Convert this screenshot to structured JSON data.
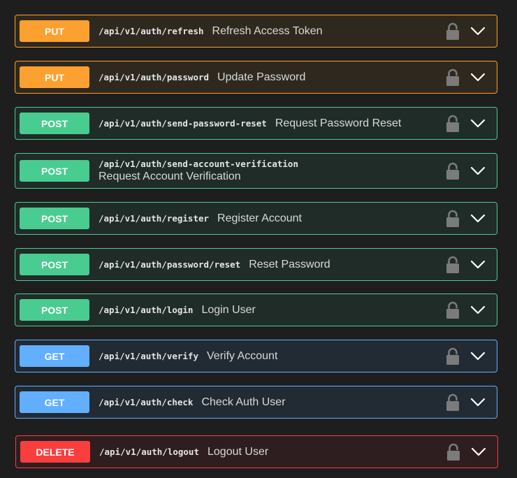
{
  "operations": [
    {
      "method": "PUT",
      "path": "/api/v1/auth/refresh",
      "summary": "Refresh Access Token",
      "lock_icon": "lock-icon",
      "expand_icon": "chevron-down-icon"
    },
    {
      "method": "PUT",
      "path": "/api/v1/auth/password",
      "summary": "Update Password",
      "lock_icon": "lock-icon",
      "expand_icon": "chevron-down-icon"
    },
    {
      "method": "POST",
      "path": "/api/v1/auth/send-password-reset",
      "summary": "Request Password Reset",
      "lock_icon": "lock-icon",
      "expand_icon": "chevron-down-icon"
    },
    {
      "method": "POST",
      "path": "/api/v1/auth/send-account-verification",
      "summary": "Request Account Verification",
      "lock_icon": "lock-icon",
      "expand_icon": "chevron-down-icon"
    },
    {
      "method": "POST",
      "path": "/api/v1/auth/register",
      "summary": "Register Account",
      "lock_icon": "lock-icon",
      "expand_icon": "chevron-down-icon"
    },
    {
      "method": "POST",
      "path": "/api/v1/auth/password/reset",
      "summary": "Reset Password",
      "lock_icon": "lock-icon",
      "expand_icon": "chevron-down-icon"
    },
    {
      "method": "POST",
      "path": "/api/v1/auth/login",
      "summary": "Login User",
      "lock_icon": "lock-icon",
      "expand_icon": "chevron-down-icon"
    },
    {
      "method": "GET",
      "path": "/api/v1/auth/verify",
      "summary": "Verify Account",
      "lock_icon": "lock-icon",
      "expand_icon": "chevron-down-icon"
    },
    {
      "method": "GET",
      "path": "/api/v1/auth/check",
      "summary": "Check Auth User",
      "lock_icon": "lock-icon",
      "expand_icon": "chevron-down-icon"
    },
    {
      "method": "DELETE",
      "path": "/api/v1/auth/logout",
      "summary": "Logout User",
      "lock_icon": "lock-icon",
      "expand_icon": "chevron-down-icon"
    }
  ],
  "colors": {
    "put": "#fca130",
    "post": "#49cc90",
    "get": "#61affe",
    "delete": "#f93e3e",
    "background": "#1e1e1e"
  }
}
